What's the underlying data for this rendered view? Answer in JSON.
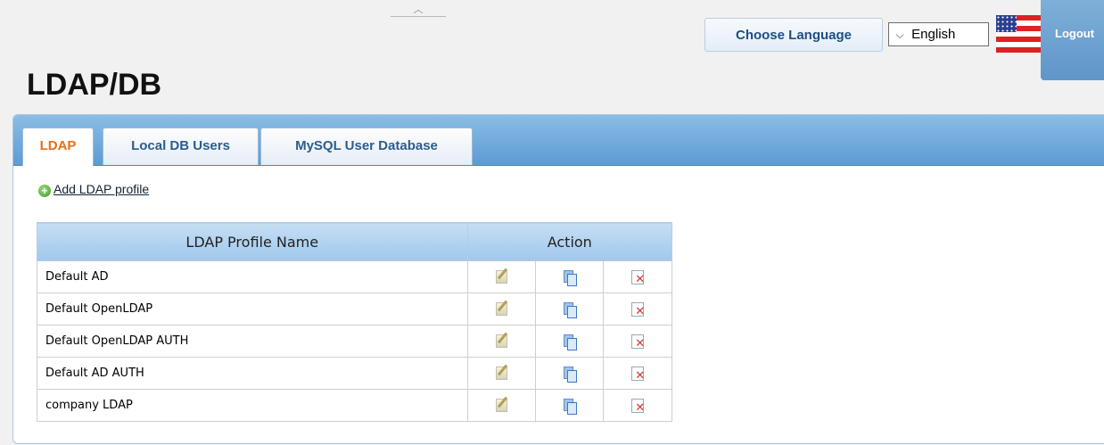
{
  "header": {
    "collapse_glyph": "︿",
    "choose_language_label": "Choose Language",
    "language_selected": "English",
    "flag_icon": "us-flag-icon",
    "logout_label": "Logout"
  },
  "page": {
    "title": "LDAP/DB"
  },
  "tabs": [
    {
      "label": "LDAP",
      "active": true
    },
    {
      "label": "Local DB Users",
      "active": false
    },
    {
      "label": "MySQL User Database",
      "active": false
    }
  ],
  "add_profile_label": "Add LDAP profile",
  "table": {
    "headers": {
      "name": "LDAP Profile Name",
      "action": "Action"
    },
    "rows": [
      {
        "name": "Default AD"
      },
      {
        "name": "Default OpenLDAP"
      },
      {
        "name": "Default OpenLDAP AUTH"
      },
      {
        "name": "Default AD AUTH"
      },
      {
        "name": "company LDAP"
      }
    ],
    "action_icons": [
      "edit-icon",
      "copy-icon",
      "delete-icon"
    ]
  },
  "colors": {
    "tab_bar": "#6fa8db",
    "active_tab_text": "#e46f17",
    "tab_text": "#2a5d91",
    "table_header": "#b3d3f0"
  }
}
